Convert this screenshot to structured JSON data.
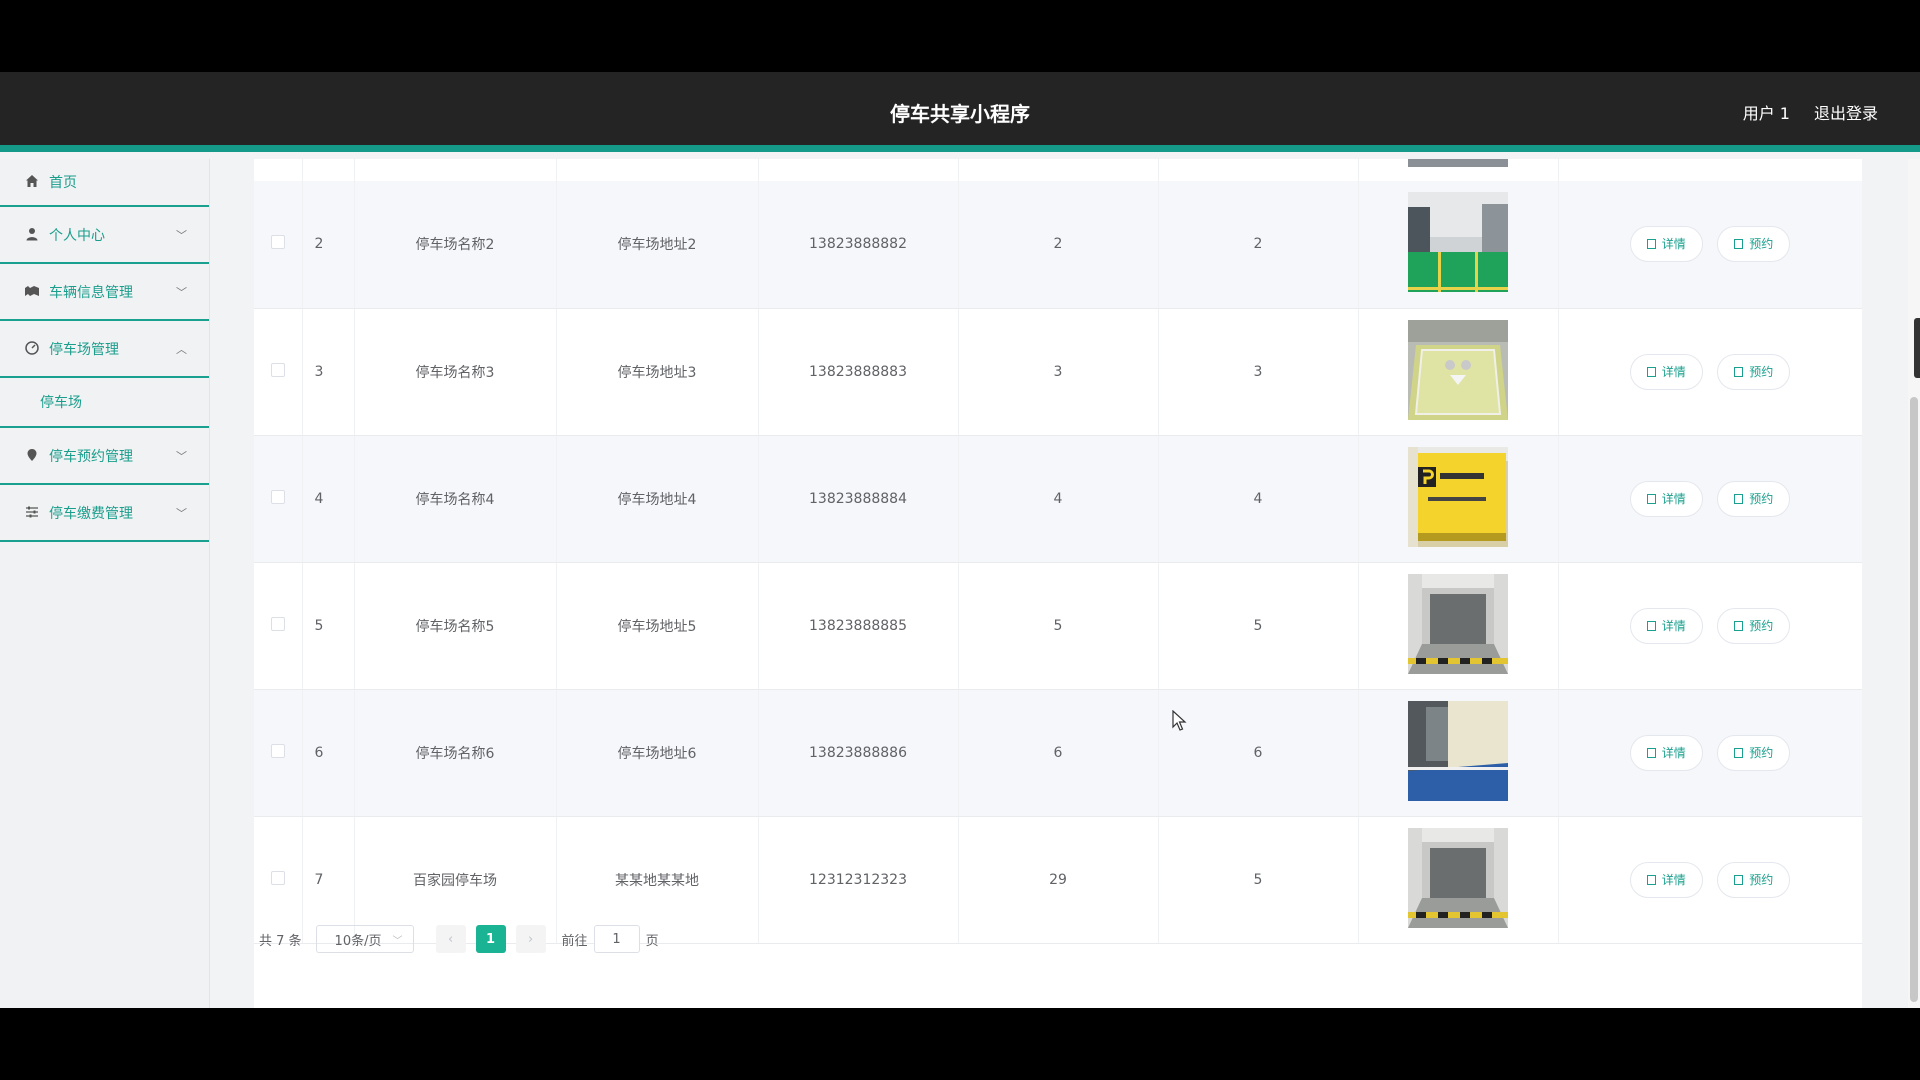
{
  "header": {
    "title": "停车共享小程序",
    "user": "用户 1",
    "logout": "退出登录"
  },
  "sidebar": {
    "items": [
      {
        "label": "首页",
        "icon": "home-icon"
      },
      {
        "label": "个人中心",
        "icon": "user-icon"
      },
      {
        "label": "车辆信息管理",
        "icon": "car-icon"
      },
      {
        "label": "停车场管理",
        "icon": "dashboard-icon"
      },
      {
        "label": "停车预约管理",
        "icon": "location-icon"
      },
      {
        "label": "停车缴费管理",
        "icon": "sliders-icon"
      }
    ],
    "submenu_parking": "停车场"
  },
  "table": {
    "rows": [
      {
        "id": "2",
        "name": "停车场名称2",
        "address": "停车场地址2",
        "phone": "13823888882",
        "c1": "2",
        "c2": "2"
      },
      {
        "id": "3",
        "name": "停车场名称3",
        "address": "停车场地址3",
        "phone": "13823888883",
        "c1": "3",
        "c2": "3"
      },
      {
        "id": "4",
        "name": "停车场名称4",
        "address": "停车场地址4",
        "phone": "13823888884",
        "c1": "4",
        "c2": "4"
      },
      {
        "id": "5",
        "name": "停车场名称5",
        "address": "停车场地址5",
        "phone": "13823888885",
        "c1": "5",
        "c2": "5"
      },
      {
        "id": "6",
        "name": "停车场名称6",
        "address": "停车场地址6",
        "phone": "13823888886",
        "c1": "6",
        "c2": "6"
      },
      {
        "id": "7",
        "name": "百家园停车场",
        "address": "某某地某某地",
        "phone": "12312312323",
        "c1": "29",
        "c2": "5"
      }
    ],
    "detail_label": "详情",
    "reserve_label": "预约"
  },
  "pagination": {
    "total": "共 7 条",
    "page_size": "10条/页",
    "current_page": "1",
    "goto_prefix": "前往",
    "goto_value": "1",
    "goto_suffix": "页"
  }
}
